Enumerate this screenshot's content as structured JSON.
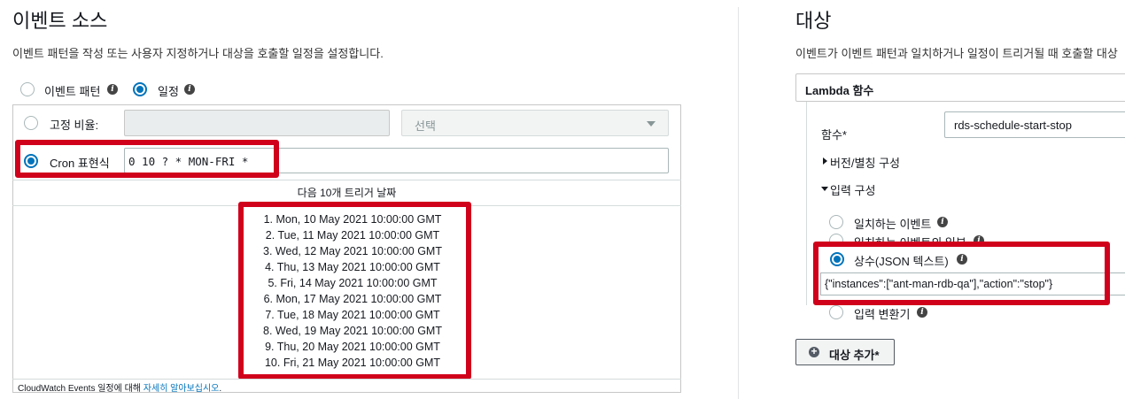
{
  "left": {
    "title": "이벤트 소스",
    "description": "이벤트 패턴을 작성 또는 사용자 지정하거나 대상을 호출할 일정을 설정합니다.",
    "source_options": {
      "event_pattern_label": "이벤트 패턴",
      "schedule_label": "일정"
    },
    "fixed_rate": {
      "label": "고정 비율:",
      "value": "",
      "unit_placeholder": "선택"
    },
    "cron": {
      "label": "Cron 표현식",
      "value": "0 10 ? * MON-FRI *"
    },
    "next_triggers_header": "다음 10개 트리거 날짜",
    "trigger_dates": [
      "1. Mon, 10 May 2021 10:00:00 GMT",
      "2. Tue, 11 May 2021 10:00:00 GMT",
      "3. Wed, 12 May 2021 10:00:00 GMT",
      "4. Thu, 13 May 2021 10:00:00 GMT",
      "5. Fri, 14 May 2021 10:00:00 GMT",
      "6. Mon, 17 May 2021 10:00:00 GMT",
      "7. Tue, 18 May 2021 10:00:00 GMT",
      "8. Wed, 19 May 2021 10:00:00 GMT",
      "9. Thu, 20 May 2021 10:00:00 GMT",
      "10. Fri, 21 May 2021 10:00:00 GMT"
    ],
    "footer_text": "CloudWatch Events 일정에 대해",
    "footer_link": "자세히 알아보십시오",
    "footer_period": "."
  },
  "right": {
    "title": "대상",
    "description": "이벤트가 이벤트 패턴과 일치하거나 일정이 트리거될 때 호출할 대상",
    "target_type": "Lambda 함수",
    "function_label": "함수*",
    "function_value": "rds-schedule-start-stop",
    "version_alias_label": "버전/별칭 구성",
    "input_config_label": "입력 구성",
    "input_options": {
      "matched_event": "일치하는 이벤트",
      "partial_event": "일치하는 이벤트의 일부",
      "constant_json": "상수(JSON 텍스트)",
      "input_transformer": "입력 변환기"
    },
    "constant_json_value": "{\"instances\":[\"ant-man-rdb-qa\"],\"action\":\"stop\"}",
    "add_target_button": "대상 추가*"
  },
  "colors": {
    "accent_blue": "#0073bb",
    "highlight_red": "#d0021b",
    "border_gray": "#aab7b8"
  }
}
